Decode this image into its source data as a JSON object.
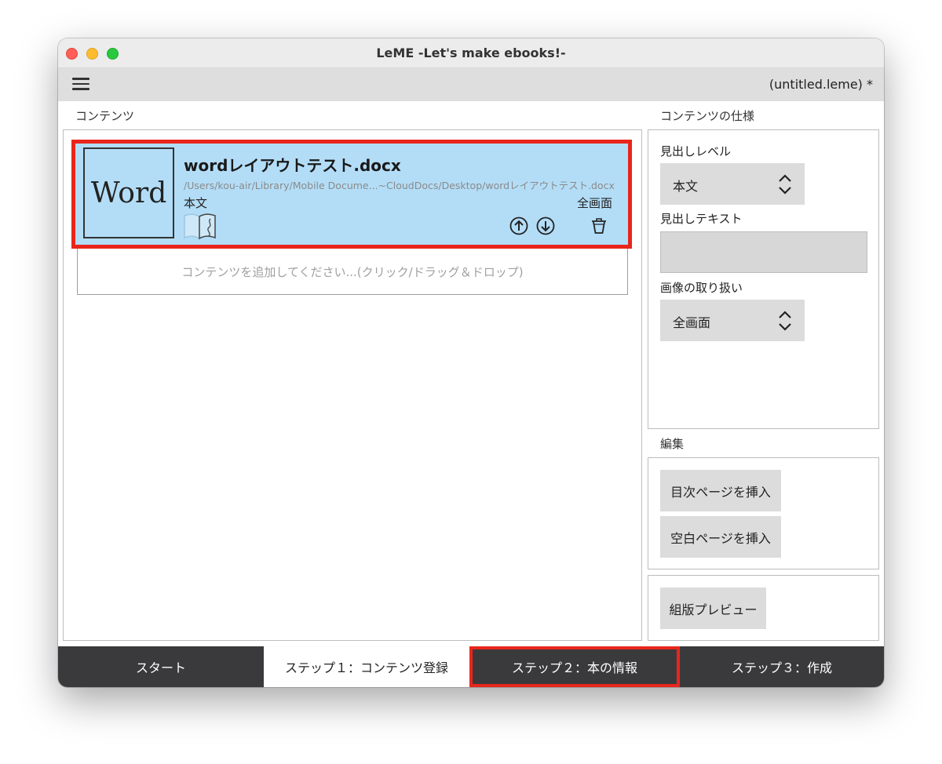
{
  "window": {
    "title": "LeME -Let's make ebooks!-",
    "file_name": "(untitled.leme)  *"
  },
  "contents": {
    "section_label": "コンテンツ",
    "items": [
      {
        "thumb_label": "Word",
        "title": "wordレイアウトテスト.docx",
        "path": "/Users/kou-air/Library/Mobile Docume...~CloudDocs/Desktop/wordレイアウトテスト.docx",
        "level": "本文",
        "image_mode": "全画面"
      }
    ],
    "add_placeholder": "コンテンツを追加してください...(クリック/ドラッグ＆ドロップ)"
  },
  "spec": {
    "section_label": "コンテンツの仕様",
    "heading_level_label": "見出しレベル",
    "heading_level_value": "本文",
    "heading_text_label": "見出しテキスト",
    "heading_text_value": "",
    "image_handling_label": "画像の取り扱い",
    "image_handling_value": "全画面"
  },
  "edit": {
    "section_label": "編集",
    "insert_toc": "目次ページを挿入",
    "insert_blank": "空白ページを挿入"
  },
  "preview": {
    "label": "組版プレビュー"
  },
  "tabs": [
    "スタート",
    "ステップ１：コンテンツ登録",
    "ステップ２：本の情報",
    "ステップ３：作成"
  ],
  "colors": {
    "item_bg": "#b3ddf7",
    "highlight": "#e8261b",
    "tab_dark": "#3a3a3c"
  },
  "icons": [
    "menu-icon",
    "word-file-icon",
    "book-icon",
    "arrow-up-icon",
    "arrow-down-icon",
    "trash-icon",
    "chevron-updown-icon"
  ]
}
